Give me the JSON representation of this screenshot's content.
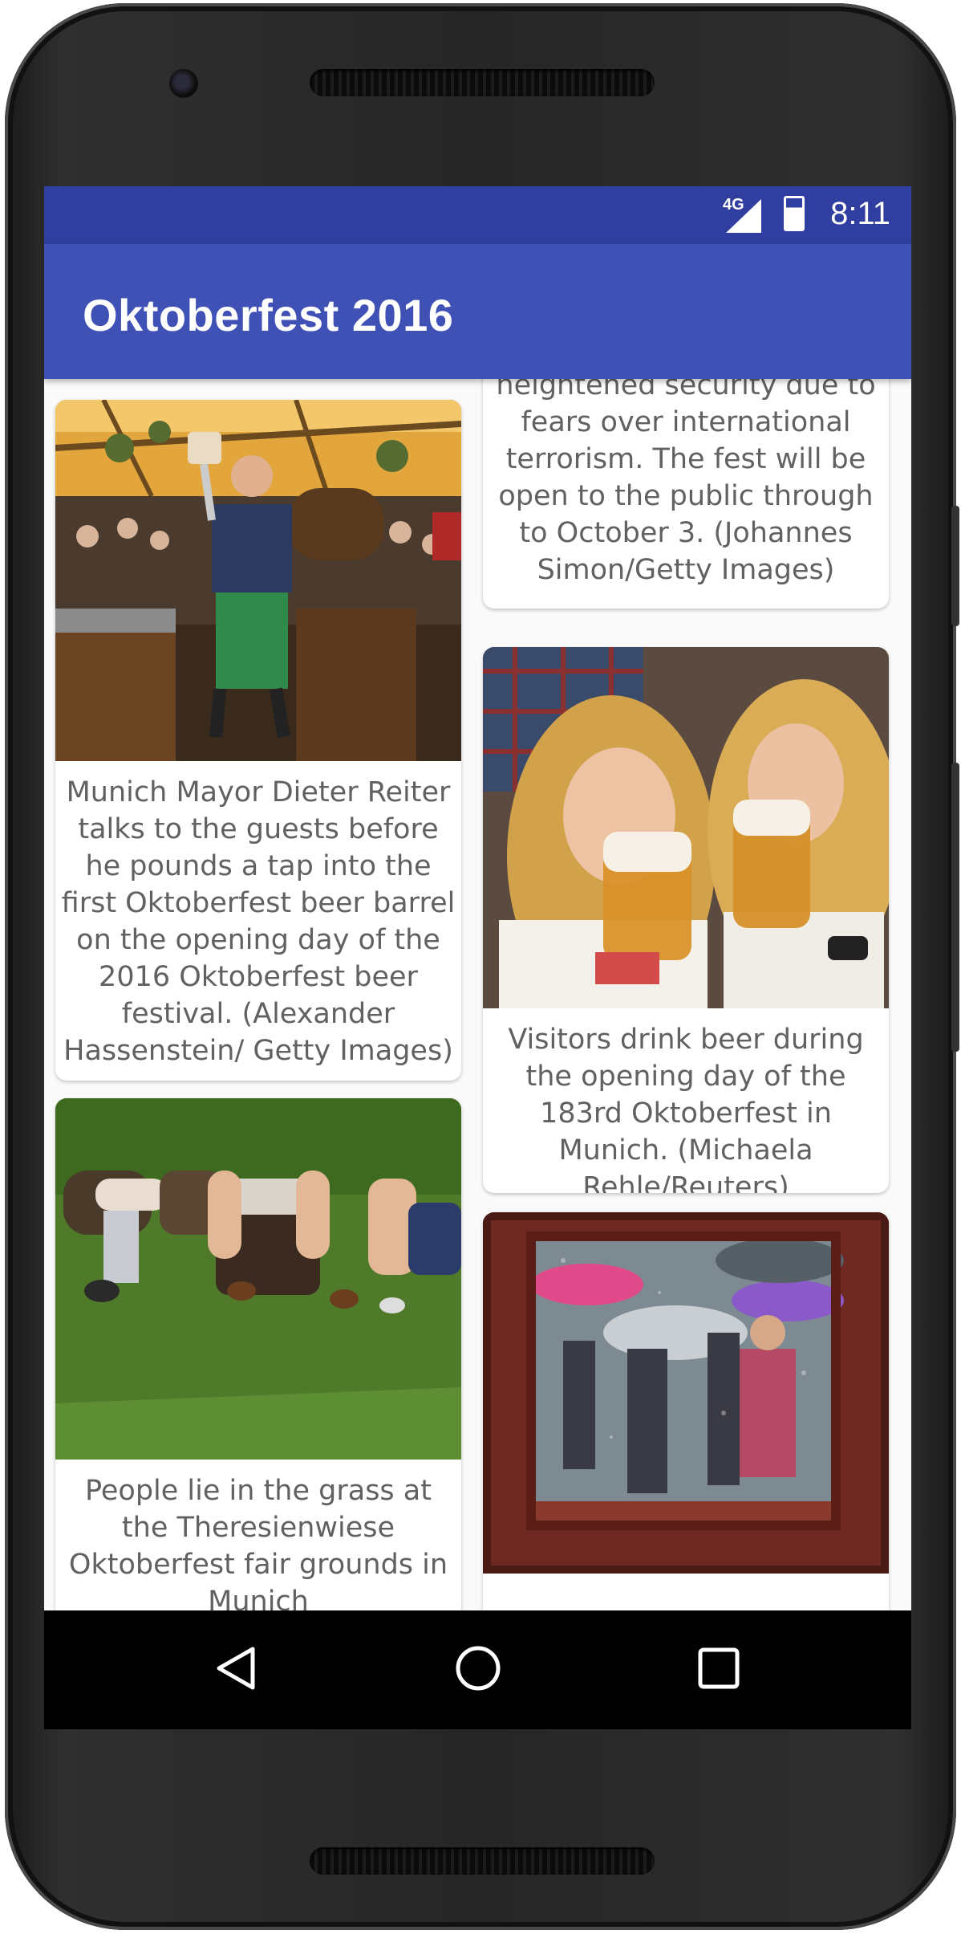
{
  "status_bar": {
    "network": "4G",
    "time": "8:11"
  },
  "app_bar": {
    "title": "Oktoberfest 2016"
  },
  "feed": {
    "left_column": [
      {
        "caption": "Munich Mayor Dieter Reiter talks to the guests before he pounds a tap into the first Oktoberfest beer barrel on the opening day of the 2016 Oktoberfest beer festival. (Alexander Hassenstein/ Getty Images)"
      },
      {
        "caption": "People lie in the grass at the Theresienwiese Oktoberfest fair grounds in Munich"
      }
    ],
    "right_column": [
      {
        "caption": "is taking place under heightened security due to fears over international terrorism. The fest will be open to the public through to October 3. (Johannes Simon/Getty Images)"
      },
      {
        "caption": "Visitors drink beer during the opening day of the 183rd Oktoberfest in Munich. (Michaela Rehle/Reuters)"
      },
      {
        "caption": ""
      }
    ]
  },
  "nav_bar": {
    "back": "back-icon",
    "home": "home-icon",
    "recents": "recents-icon"
  }
}
